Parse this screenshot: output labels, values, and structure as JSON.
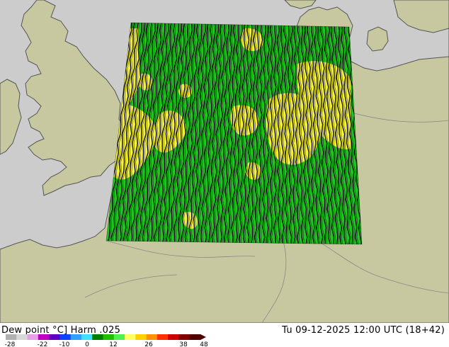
{
  "title": {
    "variable": "Dew point °C]",
    "model": "Harm .025",
    "datetime": "Tu 09-12-2025 12:00 UTC (18+42)"
  },
  "legend": {
    "ticks": [
      "-28",
      "-22",
      "-10",
      "0",
      "12",
      "26",
      "38",
      "48"
    ],
    "colors": [
      "#b0b0b0",
      "#d8d8d8",
      "#e6a0e6",
      "#c000c0",
      "#6000c0",
      "#1040ff",
      "#30a0ff",
      "#40e0ff",
      "#008000",
      "#20c000",
      "#50f050",
      "#ffff60",
      "#ffd000",
      "#ff9000",
      "#ff3000",
      "#d00000",
      "#800000",
      "#500000"
    ]
  },
  "map": {
    "sea_color": "#cccccc",
    "land_color": "#c8c8a0",
    "border_color": "#888888",
    "coast_color": "#555555",
    "field_green": "#22c422",
    "field_yellow": "#f4f040",
    "contour_color": "#000000"
  }
}
